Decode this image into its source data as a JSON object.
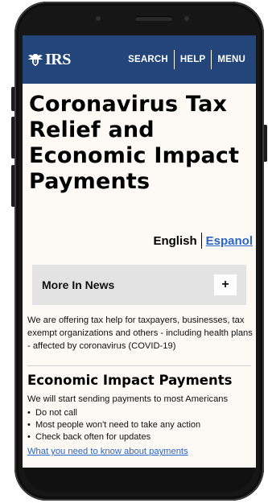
{
  "header": {
    "logo_text": "IRS",
    "logo_icon": "eagle-icon",
    "brand_color": "#23457a",
    "nav": [
      "SEARCH",
      "HELP",
      "MENU"
    ]
  },
  "page": {
    "title": "Coronavirus Tax Relief and Economic Impact Payments"
  },
  "language": {
    "current": "English",
    "alternate": "Espanol",
    "link_color": "#2a64c8"
  },
  "more_news": {
    "label": "More In News",
    "toggle": "+"
  },
  "intro_text": "We are offering tax help for taxpayers, businesses, tax exempt organizations and others - including health plans - affected by coronavirus (COVID-19)",
  "eip": {
    "heading": "Economic Impact Payments",
    "intro": "We will start sending payments to most Americans",
    "bullets": [
      "Do not call",
      "Most people won't need to take any action",
      "Check back often for updates"
    ],
    "link": "What you need to know about payments"
  }
}
